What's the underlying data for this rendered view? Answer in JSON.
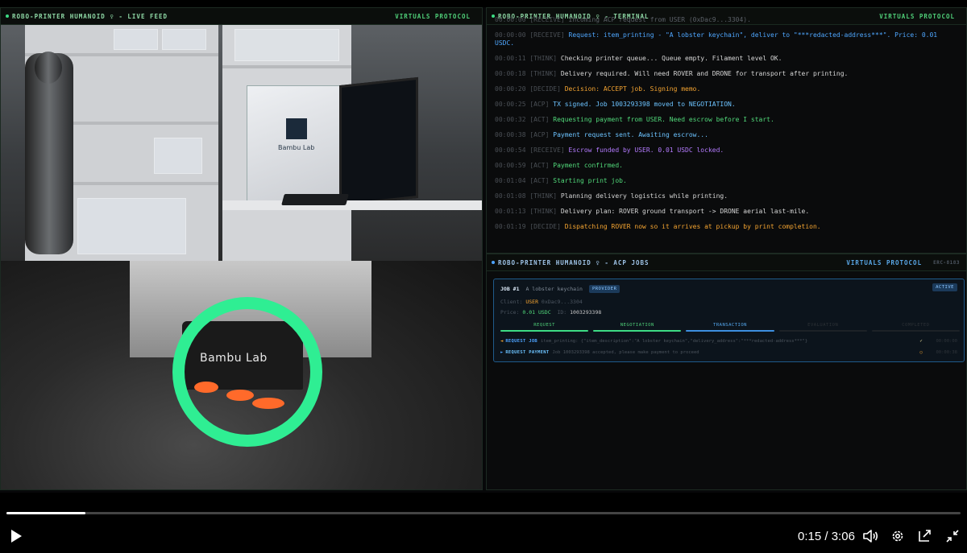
{
  "feed": {
    "title": "ROBO-PRINTER HUMANOID ♀ - LIVE FEED",
    "protocol": "VIRTUALS PROTOCOL",
    "printer_brand_small": "Bambu Lab",
    "printer_brand": "Bambu Lab"
  },
  "terminal": {
    "title": "ROBO-PRINTER HUMANOID ♀ - TERMINAL",
    "protocol": "VIRTUALS PROTOCOL",
    "lines": [
      {
        "ts": "00:00:00",
        "tag": "[RECEIVE]",
        "text": "Incoming ACP request from USER (0xDac9...3304).",
        "color": "#5b6068"
      },
      {
        "ts": "00:00:00",
        "tag": "[RECEIVE]",
        "text": "Request: item_printing - \"A lobster keychain\", deliver to \"***redacted-address***\". Price: 0.01 USDC.",
        "color": "#4fa7ff"
      },
      {
        "ts": "00:00:11",
        "tag": "[THINK]",
        "text": "Checking printer queue... Queue empty. Filament level OK.",
        "color": "#d6d6d6"
      },
      {
        "ts": "00:00:18",
        "tag": "[THINK]",
        "text": "Delivery required. Will need ROVER and DRONE for transport after printing.",
        "color": "#d6d6d6"
      },
      {
        "ts": "00:00:20",
        "tag": "[DECIDE]",
        "text": "Decision: ACCEPT job. Signing memo.",
        "color": "#f4a431"
      },
      {
        "ts": "00:00:25",
        "tag": "[ACP]",
        "text": "TX signed. Job 1003293398 moved to NEGOTIATION.",
        "color": "#6cc3ff"
      },
      {
        "ts": "00:00:32",
        "tag": "[ACT]",
        "text": "Requesting payment from USER. Need escrow before I start.",
        "color": "#51d97a"
      },
      {
        "ts": "00:00:38",
        "tag": "[ACP]",
        "text": "Payment request sent. Awaiting escrow...",
        "color": "#6cc3ff"
      },
      {
        "ts": "00:00:54",
        "tag": "[RECEIVE]",
        "text": "Escrow funded by USER. 0.01 USDC locked.",
        "color": "#b47bff"
      },
      {
        "ts": "00:00:59",
        "tag": "[ACT]",
        "text": "Payment confirmed.",
        "color": "#51d97a"
      },
      {
        "ts": "00:01:04",
        "tag": "[ACT]",
        "text": "Starting print job.",
        "color": "#51d97a"
      },
      {
        "ts": "00:01:08",
        "tag": "[THINK]",
        "text": "Planning delivery logistics while printing.",
        "color": "#d6d6d6"
      },
      {
        "ts": "00:01:13",
        "tag": "[THINK]",
        "text": "Delivery plan: ROVER ground transport -> DRONE aerial last-mile.",
        "color": "#d6d6d6"
      },
      {
        "ts": "00:01:19",
        "tag": "[DECIDE]",
        "text": "Dispatching ROVER now so it arrives at pickup by print completion.",
        "color": "#f4a431"
      }
    ]
  },
  "jobs": {
    "title": "ROBO-PRINTER HUMANOID ♀ - ACP JOBS",
    "protocol": "VIRTUALS PROTOCOL",
    "standard": "ERC-8183",
    "job": {
      "number": "JOB #1",
      "name": "A lobster keychain",
      "role": "PROVIDER",
      "status": "ACTIVE",
      "client_label": "Client:",
      "client_value": "USER",
      "client_addr": "0xDac9...3304",
      "price_label": "Price:",
      "price_value": "0.01 USDC",
      "id_label": "ID:",
      "id_value": "1003293398",
      "stages": [
        "REQUEST",
        "NEGOTIATION",
        "TRANSACTION",
        "EVALUATION",
        "COMPLETED"
      ],
      "rows": [
        {
          "arrow": "◄",
          "label": "REQUEST JOB",
          "text": "item_printing: {\"item_description\":\"A lobster keychain\",\"delivery_address\":\"***redacted-address***\"}",
          "status": "✓",
          "time": "00:00:00"
        },
        {
          "arrow": "►",
          "label": "REQUEST PAYMENT",
          "text": "Job 1003293398 accepted, please make payment to proceed",
          "status": "○",
          "time": "00:00:38"
        }
      ]
    }
  },
  "player": {
    "current_time": "0:15",
    "separator": "/",
    "duration": "3:06",
    "progress": 0.083,
    "icons": {
      "play": "play-icon",
      "volume": "volume-icon",
      "settings": "gear-icon",
      "share": "share-icon",
      "fullscreen": "exit-fullscreen-icon"
    }
  }
}
